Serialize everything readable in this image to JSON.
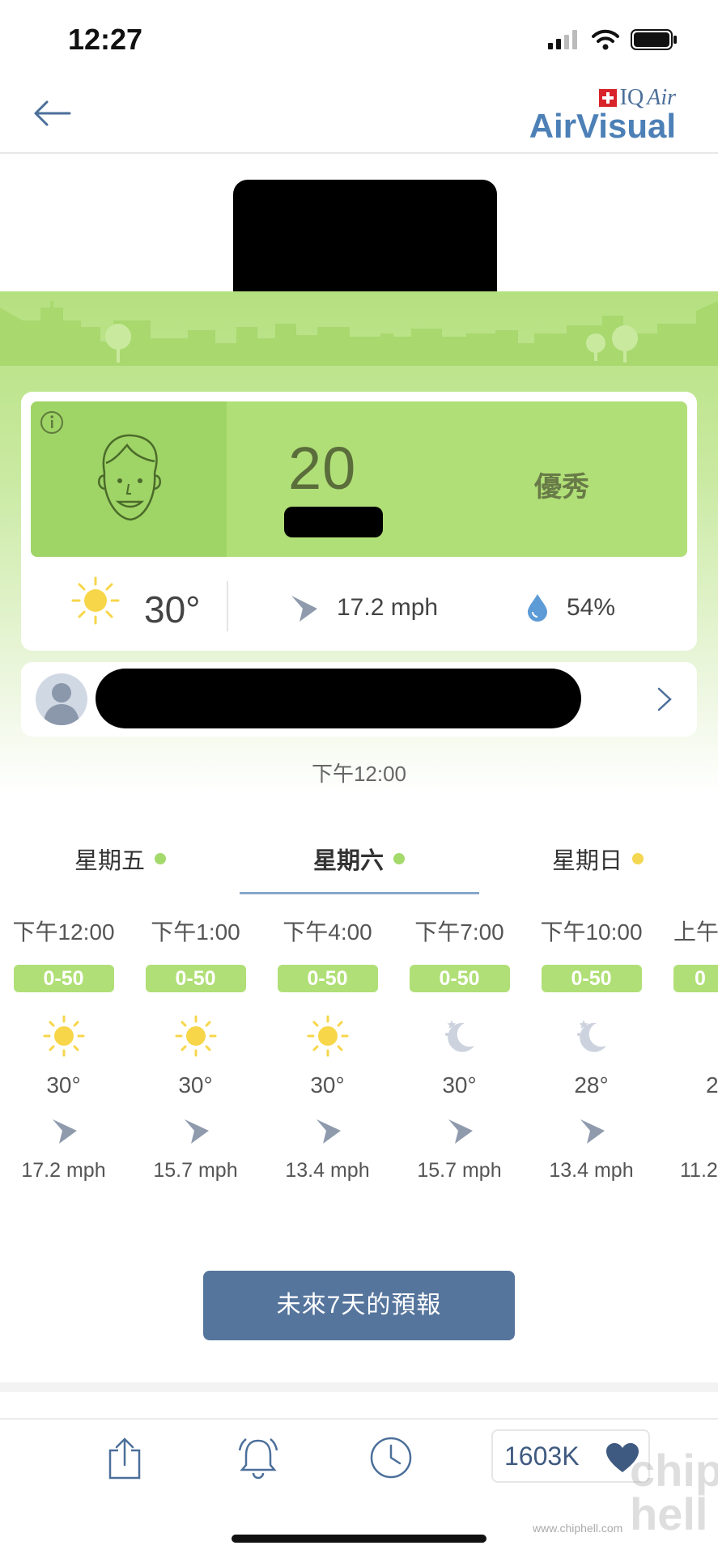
{
  "status_bar": {
    "time": "12:27"
  },
  "header": {
    "logo_brand": "IQAir",
    "logo_brand_prefix": "IQ",
    "logo_brand_suffix": "Air",
    "logo_app": "AirVisual"
  },
  "aqi": {
    "value": "20",
    "level": "優秀",
    "color": "#b0df77"
  },
  "current_weather": {
    "temperature": "30°",
    "wind": "17.2 mph",
    "humidity": "54%"
  },
  "update_time": "下午12:00",
  "day_tabs": [
    {
      "label": "星期五",
      "dot_color": "#a4d96b"
    },
    {
      "label": "星期六",
      "dot_color": "#a4d96b"
    },
    {
      "label": "星期日",
      "dot_color": "#f4d752"
    }
  ],
  "hourly": [
    {
      "time": "下午12:00",
      "aqi": "0-50",
      "icon": "sun-icon",
      "temp": "30°",
      "wind": "17.2 mph"
    },
    {
      "time": "下午1:00",
      "aqi": "0-50",
      "icon": "sun-icon",
      "temp": "30°",
      "wind": "15.7 mph"
    },
    {
      "time": "下午4:00",
      "aqi": "0-50",
      "icon": "sun-icon",
      "temp": "30°",
      "wind": "13.4 mph"
    },
    {
      "time": "下午7:00",
      "aqi": "0-50",
      "icon": "moon-icon",
      "temp": "30°",
      "wind": "15.7 mph"
    },
    {
      "time": "下午10:00",
      "aqi": "0-50",
      "icon": "moon-icon",
      "temp": "28°",
      "wind": "13.4 mph"
    },
    {
      "time": "上午",
      "aqi": "0",
      "icon": "moon-icon",
      "temp": "2",
      "wind": "11.2"
    }
  ],
  "forecast_button": "未來7天的預報",
  "tab_bar": {
    "like_count": "1603K"
  },
  "watermark": {
    "url": "www.chiphell.com",
    "logo": "chip hell"
  }
}
